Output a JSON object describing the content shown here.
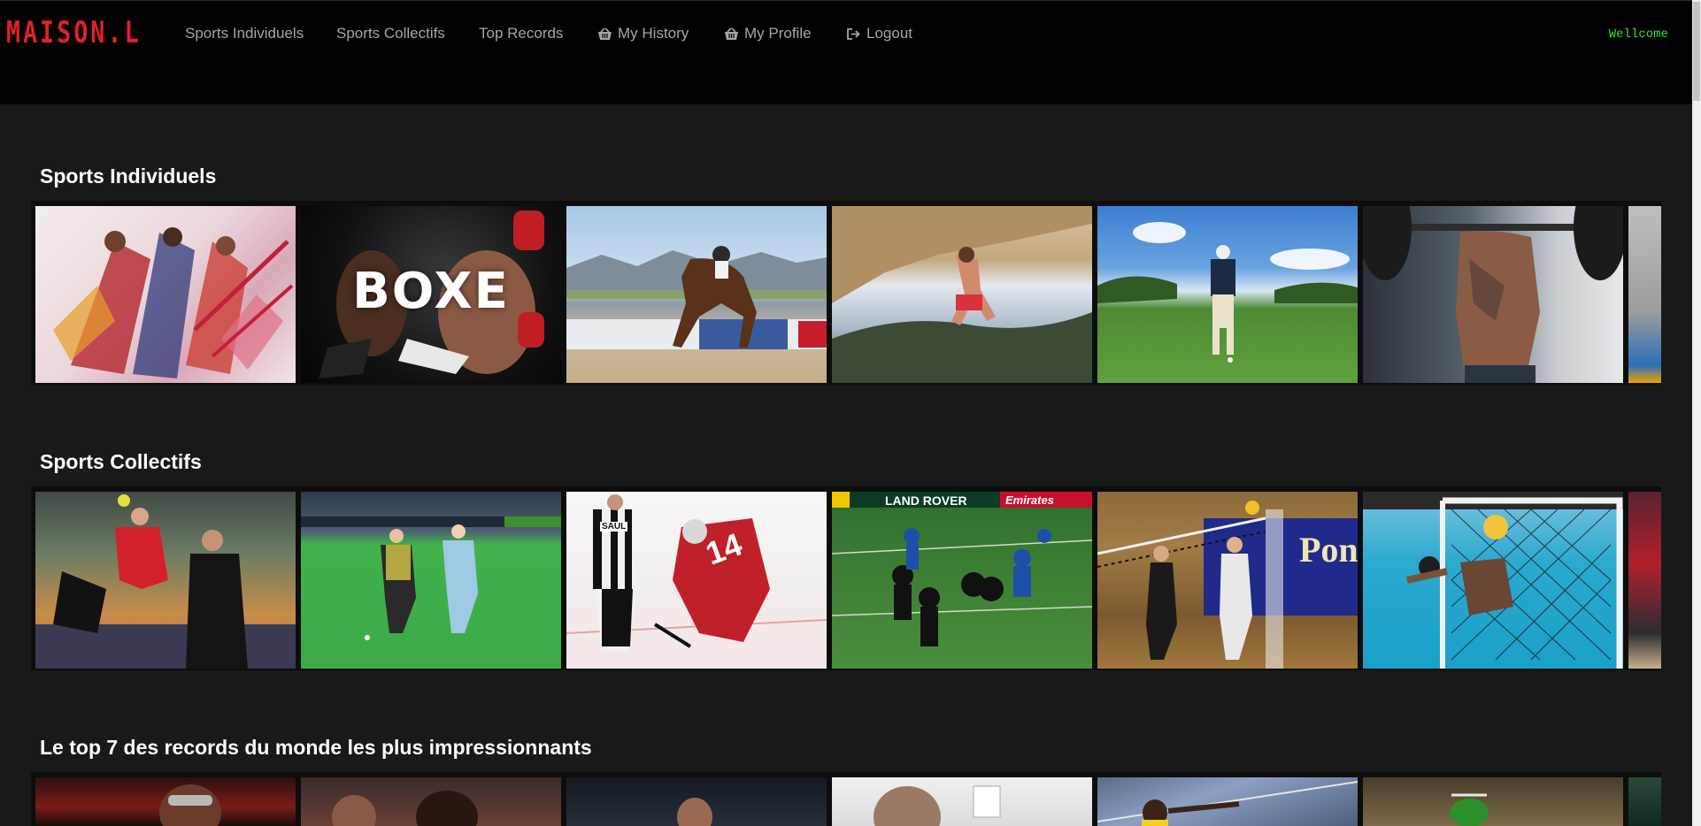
{
  "brand": "MAISON.L",
  "nav": [
    {
      "label": "Sports Individuels",
      "icon": ""
    },
    {
      "label": "Sports Collectifs",
      "icon": ""
    },
    {
      "label": "Top Records",
      "icon": ""
    },
    {
      "label": "My History",
      "icon": "basket-icon"
    },
    {
      "label": "My Profile",
      "icon": "basket-icon"
    },
    {
      "label": "Logout",
      "icon": "sign-out-icon"
    }
  ],
  "welcome": "Wellcome",
  "sections": [
    {
      "title": "Sports Individuels"
    },
    {
      "title": "Sports Collectifs"
    },
    {
      "title": "Le top 7 des records du monde les plus impressionnants"
    }
  ],
  "row1_images": {
    "boxe_text": "BOXE"
  },
  "row2_images": {
    "rugby_banner_left": "LAND ROVER",
    "rugby_banner_right": "Emirates",
    "hockey_jersey": "14",
    "referee_name": "SAUL",
    "volley_banner": "Pon"
  },
  "colors": {
    "brand": "#e0212a",
    "welcome": "#2ee52e",
    "nav_text": "#a6a6a6",
    "page_bg": "#181a1a"
  }
}
